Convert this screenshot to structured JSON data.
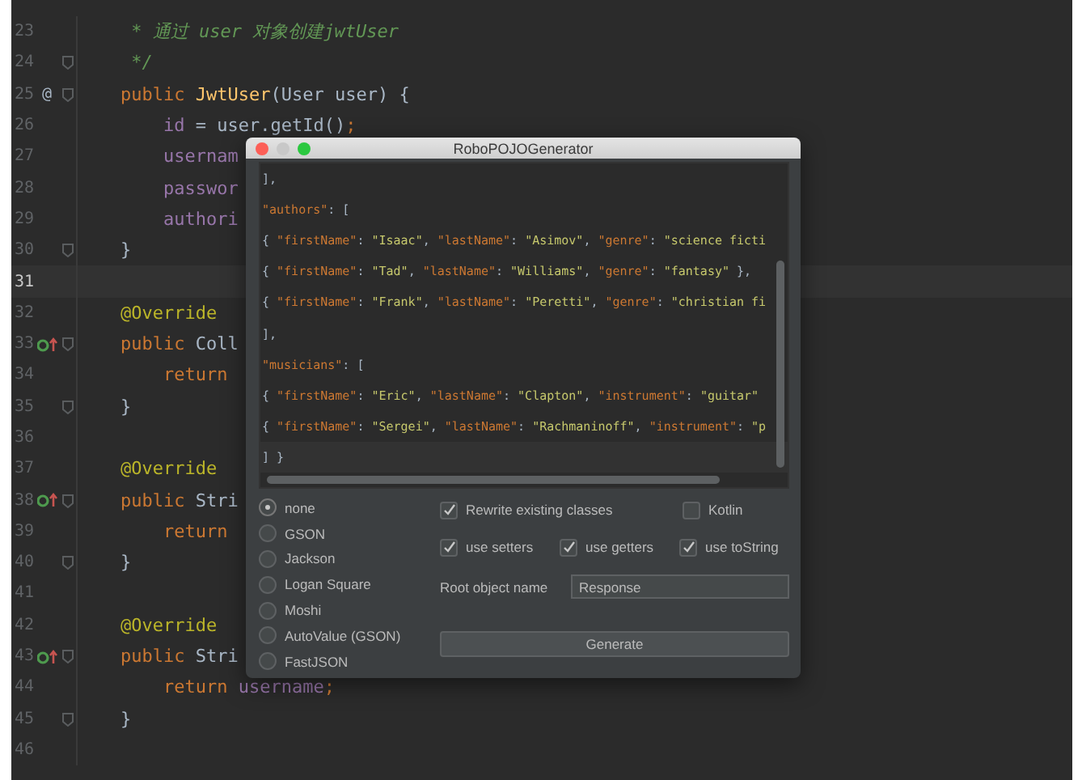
{
  "editor": {
    "lines": [
      {
        "number": "23",
        "kind": "plain",
        "fold": false,
        "current": false,
        "tokens": [
          {
            "text": "     * 通过 user 对象创建jwtUser",
            "kind": "comment"
          }
        ]
      },
      {
        "number": "24",
        "kind": "plain",
        "fold": true,
        "current": false,
        "tokens": [
          {
            "text": "     */",
            "kind": "comment"
          }
        ]
      },
      {
        "number": "25",
        "kind": "plain",
        "gutter": "@",
        "fold": true,
        "current": false,
        "tokens": [
          {
            "text": "    public ",
            "kind": "keyword"
          },
          {
            "text": "JwtUser",
            "kind": "method"
          },
          {
            "text": "(User user) {",
            "kind": "plain"
          }
        ]
      },
      {
        "number": "26",
        "kind": "plain",
        "fold": false,
        "current": false,
        "tokens": [
          {
            "text": "        id",
            "kind": "field"
          },
          {
            "text": " = user.getId()",
            "kind": "plain"
          },
          {
            "text": ";",
            "kind": "keyword"
          }
        ]
      },
      {
        "number": "27",
        "kind": "plain",
        "fold": false,
        "current": false,
        "tokens": [
          {
            "text": "        usernam",
            "kind": "field"
          }
        ]
      },
      {
        "number": "28",
        "kind": "plain",
        "fold": false,
        "current": false,
        "tokens": [
          {
            "text": "        passwor",
            "kind": "field"
          }
        ]
      },
      {
        "number": "29",
        "kind": "plain",
        "fold": false,
        "current": false,
        "tokens": [
          {
            "text": "        authori",
            "kind": "field"
          }
        ]
      },
      {
        "number": "30",
        "kind": "plain",
        "fold": true,
        "current": false,
        "tokens": [
          {
            "text": "    }",
            "kind": "plain"
          }
        ]
      },
      {
        "number": "31",
        "kind": "plain",
        "fold": false,
        "current": true
      },
      {
        "number": "32",
        "kind": "plain",
        "fold": false,
        "current": false,
        "tokens": [
          {
            "text": "    @Override",
            "kind": "annotation"
          }
        ]
      },
      {
        "number": "33",
        "kind": "override",
        "fold": true,
        "current": false,
        "tokens": [
          {
            "text": "    public ",
            "kind": "keyword"
          },
          {
            "text": "Coll",
            "kind": "plain"
          }
        ]
      },
      {
        "number": "34",
        "kind": "plain",
        "fold": false,
        "current": false,
        "tokens": [
          {
            "text": "        return",
            "kind": "keyword"
          }
        ]
      },
      {
        "number": "35",
        "kind": "plain",
        "fold": true,
        "current": false,
        "tokens": [
          {
            "text": "    }",
            "kind": "plain"
          }
        ]
      },
      {
        "number": "36",
        "kind": "plain",
        "fold": false,
        "current": false
      },
      {
        "number": "37",
        "kind": "plain",
        "fold": false,
        "current": false,
        "tokens": [
          {
            "text": "    @Override",
            "kind": "annotation"
          }
        ]
      },
      {
        "number": "38",
        "kind": "override",
        "fold": true,
        "current": false,
        "tokens": [
          {
            "text": "    public ",
            "kind": "keyword"
          },
          {
            "text": "Stri",
            "kind": "plain"
          }
        ]
      },
      {
        "number": "39",
        "kind": "plain",
        "fold": false,
        "current": false,
        "tokens": [
          {
            "text": "        return",
            "kind": "keyword"
          }
        ]
      },
      {
        "number": "40",
        "kind": "plain",
        "fold": true,
        "current": false,
        "tokens": [
          {
            "text": "    }",
            "kind": "plain"
          }
        ]
      },
      {
        "number": "41",
        "kind": "plain",
        "fold": false,
        "current": false
      },
      {
        "number": "42",
        "kind": "plain",
        "fold": false,
        "current": false,
        "tokens": [
          {
            "text": "    @Override",
            "kind": "annotation"
          }
        ]
      },
      {
        "number": "43",
        "kind": "override",
        "fold": true,
        "current": false,
        "tokens": [
          {
            "text": "    public ",
            "kind": "keyword"
          },
          {
            "text": "Stri",
            "kind": "plain"
          }
        ]
      },
      {
        "number": "44",
        "kind": "plain",
        "fold": false,
        "current": false,
        "tokens": [
          {
            "text": "        return ",
            "kind": "keyword"
          },
          {
            "text": "username",
            "kind": "field"
          },
          {
            "text": ";",
            "kind": "keyword"
          }
        ]
      },
      {
        "number": "45",
        "kind": "plain",
        "fold": true,
        "current": false,
        "tokens": [
          {
            "text": "    }",
            "kind": "plain"
          }
        ]
      },
      {
        "number": "46",
        "kind": "plain",
        "fold": false,
        "current": false
      }
    ]
  },
  "dialog": {
    "title": "RoboPOJOGenerator",
    "json_lines": [
      [
        {
          "text": "],",
          "kind": "punct"
        }
      ],
      [
        {
          "text": "\"authors\"",
          "kind": "key"
        },
        {
          "text": ": [",
          "kind": "punct"
        }
      ],
      [
        {
          "text": "{ ",
          "kind": "punct"
        },
        {
          "text": "\"firstName\"",
          "kind": "key"
        },
        {
          "text": ": ",
          "kind": "punct"
        },
        {
          "text": "\"Isaac\"",
          "kind": "value"
        },
        {
          "text": ", ",
          "kind": "punct"
        },
        {
          "text": "\"lastName\"",
          "kind": "key"
        },
        {
          "text": ": ",
          "kind": "punct"
        },
        {
          "text": "\"Asimov\"",
          "kind": "value"
        },
        {
          "text": ", ",
          "kind": "punct"
        },
        {
          "text": "\"genre\"",
          "kind": "key"
        },
        {
          "text": ": ",
          "kind": "punct"
        },
        {
          "text": "\"science ficti",
          "kind": "value"
        }
      ],
      [
        {
          "text": "{ ",
          "kind": "punct"
        },
        {
          "text": "\"firstName\"",
          "kind": "key"
        },
        {
          "text": ": ",
          "kind": "punct"
        },
        {
          "text": "\"Tad\"",
          "kind": "value"
        },
        {
          "text": ", ",
          "kind": "punct"
        },
        {
          "text": "\"lastName\"",
          "kind": "key"
        },
        {
          "text": ": ",
          "kind": "punct"
        },
        {
          "text": "\"Williams\"",
          "kind": "value"
        },
        {
          "text": ", ",
          "kind": "punct"
        },
        {
          "text": "\"genre\"",
          "kind": "key"
        },
        {
          "text": ": ",
          "kind": "punct"
        },
        {
          "text": "\"fantasy\"",
          "kind": "value"
        },
        {
          "text": " },",
          "kind": "punct"
        }
      ],
      [
        {
          "text": "{ ",
          "kind": "punct"
        },
        {
          "text": "\"firstName\"",
          "kind": "key"
        },
        {
          "text": ": ",
          "kind": "punct"
        },
        {
          "text": "\"Frank\"",
          "kind": "value"
        },
        {
          "text": ", ",
          "kind": "punct"
        },
        {
          "text": "\"lastName\"",
          "kind": "key"
        },
        {
          "text": ": ",
          "kind": "punct"
        },
        {
          "text": "\"Peretti\"",
          "kind": "value"
        },
        {
          "text": ", ",
          "kind": "punct"
        },
        {
          "text": "\"genre\"",
          "kind": "key"
        },
        {
          "text": ": ",
          "kind": "punct"
        },
        {
          "text": "\"christian fi",
          "kind": "value"
        }
      ],
      [
        {
          "text": "],",
          "kind": "punct"
        }
      ],
      [
        {
          "text": "\"musicians\"",
          "kind": "key"
        },
        {
          "text": ": [",
          "kind": "punct"
        }
      ],
      [
        {
          "text": "{ ",
          "kind": "punct"
        },
        {
          "text": "\"firstName\"",
          "kind": "key"
        },
        {
          "text": ": ",
          "kind": "punct"
        },
        {
          "text": "\"Eric\"",
          "kind": "value"
        },
        {
          "text": ", ",
          "kind": "punct"
        },
        {
          "text": "\"lastName\"",
          "kind": "key"
        },
        {
          "text": ": ",
          "kind": "punct"
        },
        {
          "text": "\"Clapton\"",
          "kind": "value"
        },
        {
          "text": ", ",
          "kind": "punct"
        },
        {
          "text": "\"instrument\"",
          "kind": "key"
        },
        {
          "text": ": ",
          "kind": "punct"
        },
        {
          "text": "\"guitar\"",
          "kind": "value"
        }
      ],
      [
        {
          "text": "{ ",
          "kind": "punct"
        },
        {
          "text": "\"firstName\"",
          "kind": "key"
        },
        {
          "text": ": ",
          "kind": "punct"
        },
        {
          "text": "\"Sergei\"",
          "kind": "value"
        },
        {
          "text": ", ",
          "kind": "punct"
        },
        {
          "text": "\"lastName\"",
          "kind": "key"
        },
        {
          "text": ": ",
          "kind": "punct"
        },
        {
          "text": "\"Rachmaninoff\"",
          "kind": "value"
        },
        {
          "text": ", ",
          "kind": "punct"
        },
        {
          "text": "\"instrument\"",
          "kind": "key"
        },
        {
          "text": ": ",
          "kind": "punct"
        },
        {
          "text": "\"p",
          "kind": "value"
        }
      ],
      [
        {
          "text": "] }",
          "kind": "punct"
        }
      ]
    ],
    "frameworks": [
      {
        "label": "none",
        "selected": true
      },
      {
        "label": "GSON",
        "selected": false
      },
      {
        "label": "Jackson",
        "selected": false
      },
      {
        "label": "Logan Square",
        "selected": false
      },
      {
        "label": "Moshi",
        "selected": false
      },
      {
        "label": "AutoValue (GSON)",
        "selected": false
      },
      {
        "label": "FastJSON",
        "selected": false
      }
    ],
    "option_rows": [
      [
        {
          "label": "Rewrite existing classes",
          "checked": true
        },
        {
          "label": "Kotlin",
          "checked": false
        }
      ],
      [
        {
          "label": "use setters",
          "checked": true
        },
        {
          "label": "use getters",
          "checked": true
        },
        {
          "label": "use toString",
          "checked": true
        }
      ]
    ],
    "root_object": {
      "label": "Root object name",
      "value": "Response"
    },
    "button": "Generate"
  }
}
